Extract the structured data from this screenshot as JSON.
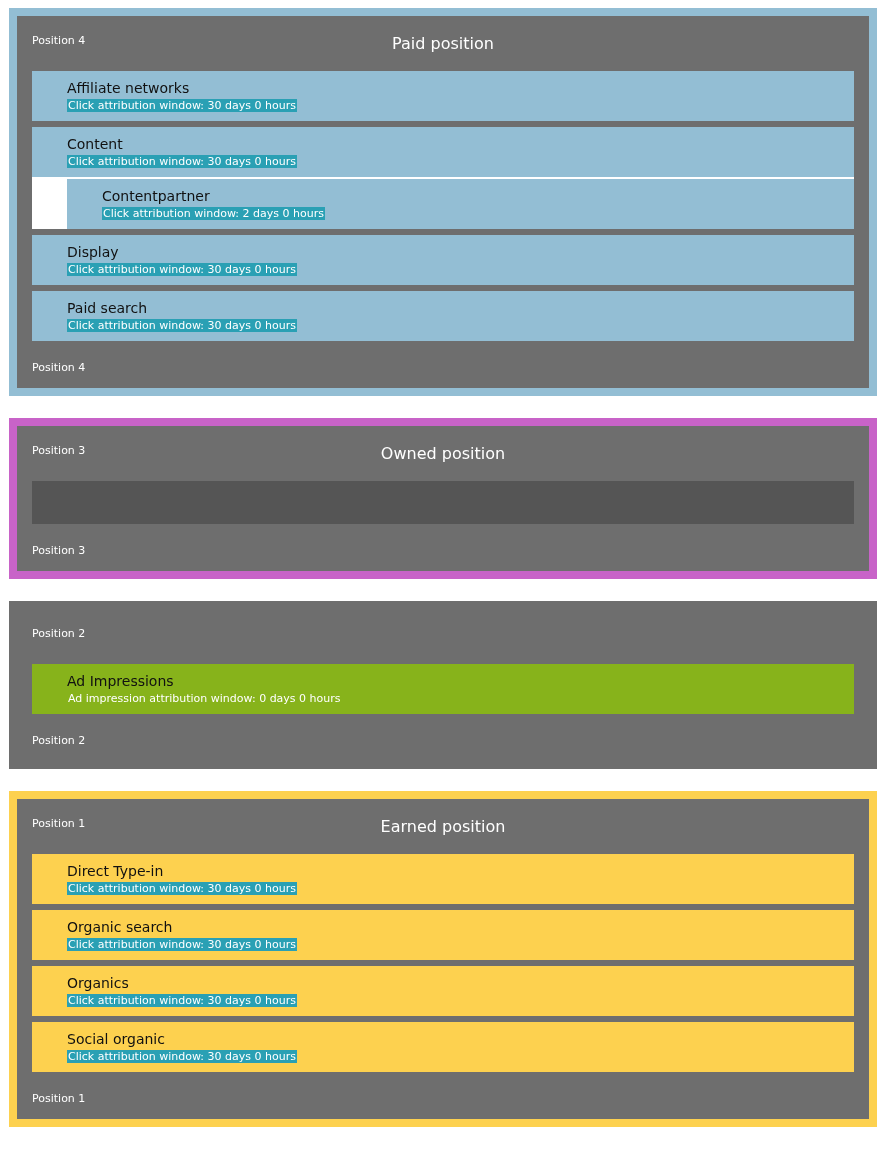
{
  "sections": [
    {
      "position_top": "Position 4",
      "title": "Paid position",
      "color": "#93bed4",
      "position_bottom": "Position 4",
      "items": [
        {
          "name": "Affiliate networks",
          "detail": "Click attribution window: 30 days 0 hours",
          "highlighted": true,
          "color": "#93bed4"
        },
        {
          "name": "Content",
          "detail": "Click attribution window: 30 days 0 hours",
          "highlighted": true,
          "color": "#93bed4",
          "children": [
            {
              "name": "Contentpartner",
              "detail": "Click attribution window: 2 days 0 hours",
              "highlighted": true,
              "color": "#93bed4"
            }
          ]
        },
        {
          "name": "Display",
          "detail": "Click attribution window: 30 days 0 hours",
          "highlighted": true,
          "color": "#93bed4"
        },
        {
          "name": "Paid search",
          "detail": "Click attribution window: 30 days 0 hours",
          "highlighted": true,
          "color": "#93bed4"
        }
      ]
    },
    {
      "position_top": "Position 3",
      "title": "Owned position",
      "color": "#c863c8",
      "position_bottom": "Position 3"
    },
    {
      "position_top": "Position 2",
      "position_bottom": "Position 2",
      "items": [
        {
          "name": "Ad Impressions",
          "detail": "Ad impression attribution window: 0 days 0 hours",
          "highlighted": false,
          "color": "#87b31b"
        }
      ]
    },
    {
      "position_top": "Position 1",
      "title": "Earned position",
      "color": "#fdd14f",
      "position_bottom": "Position 1",
      "items": [
        {
          "name": "Direct Type-in",
          "detail": "Click attribution window: 30 days 0 hours",
          "highlighted": true,
          "color": "#fdd14f"
        },
        {
          "name": "Organic search",
          "detail": "Click attribution window: 30 days 0 hours",
          "highlighted": true,
          "color": "#fdd14f"
        },
        {
          "name": "Organics",
          "detail": "Click attribution window: 30 days 0 hours",
          "highlighted": true,
          "color": "#fdd14f"
        },
        {
          "name": "Social organic",
          "detail": "Click attribution window: 30 days 0 hours",
          "highlighted": true,
          "color": "#fdd14f"
        }
      ]
    }
  ]
}
